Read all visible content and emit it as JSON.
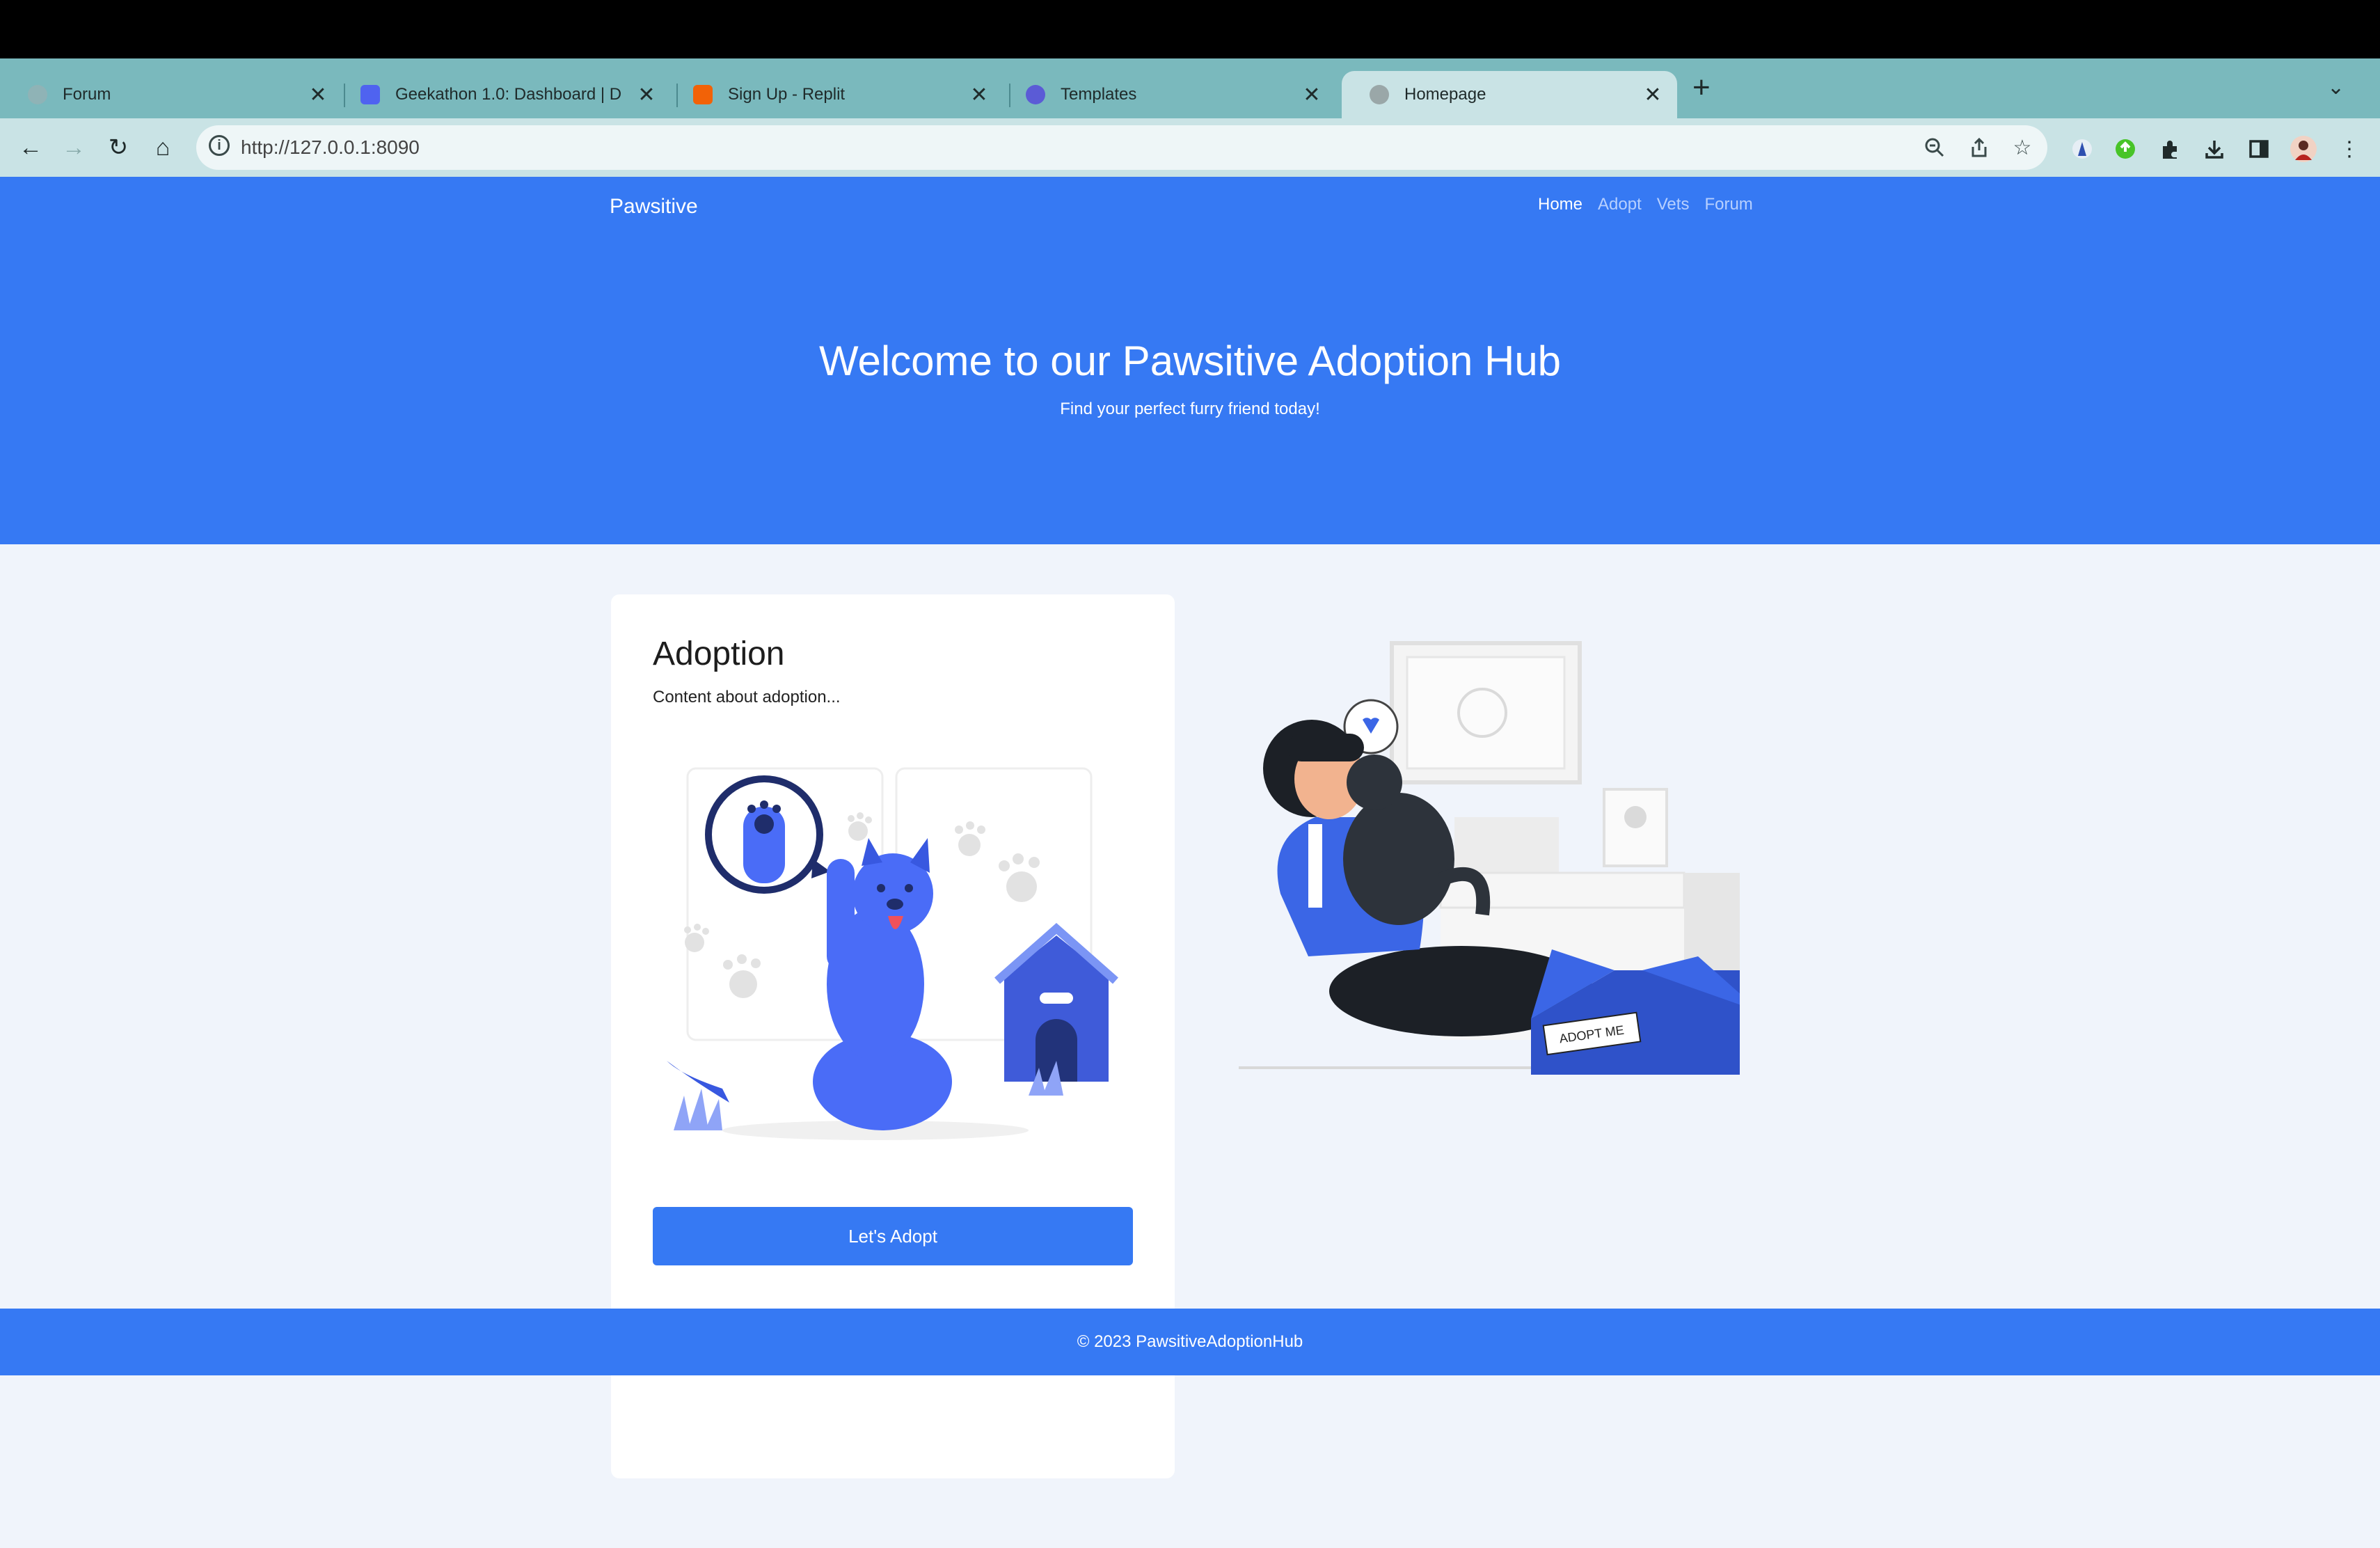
{
  "browser": {
    "tabs": [
      {
        "label": "Forum",
        "favicon_color": "#8fb3b6"
      },
      {
        "label": "Geekathon 1.0: Dashboard | D",
        "favicon_color": "#4f63f0"
      },
      {
        "label": "Sign Up - Replit",
        "favicon_color": "#f26207"
      },
      {
        "label": "Templates",
        "favicon_color": "#5b5bd6"
      },
      {
        "label": "Homepage",
        "favicon_color": "#9aa7a8"
      }
    ],
    "close_glyph": "✕",
    "new_tab_glyph": "+",
    "url": "http://127.0.0.1:8090"
  },
  "site": {
    "brand": "Pawsitive",
    "nav": [
      "Home",
      "Adopt",
      "Vets",
      "Forum"
    ],
    "active_nav": "Home",
    "hero_title": "Welcome to our Pawsitive Adoption Hub",
    "hero_subtitle": "Find your perfect furry friend today!",
    "card_title": "Adoption",
    "card_text": "Content about adoption...",
    "button_label": "Let's Adopt",
    "box_label": "ADOPT ME",
    "footer": "© 2023 PawsitiveAdoptionHub"
  },
  "colors": {
    "accent": "#3679f3",
    "tabstrip": "#7ab9bd",
    "toolbar": "#c9e3e5",
    "page_bg": "#f0f4fb"
  }
}
